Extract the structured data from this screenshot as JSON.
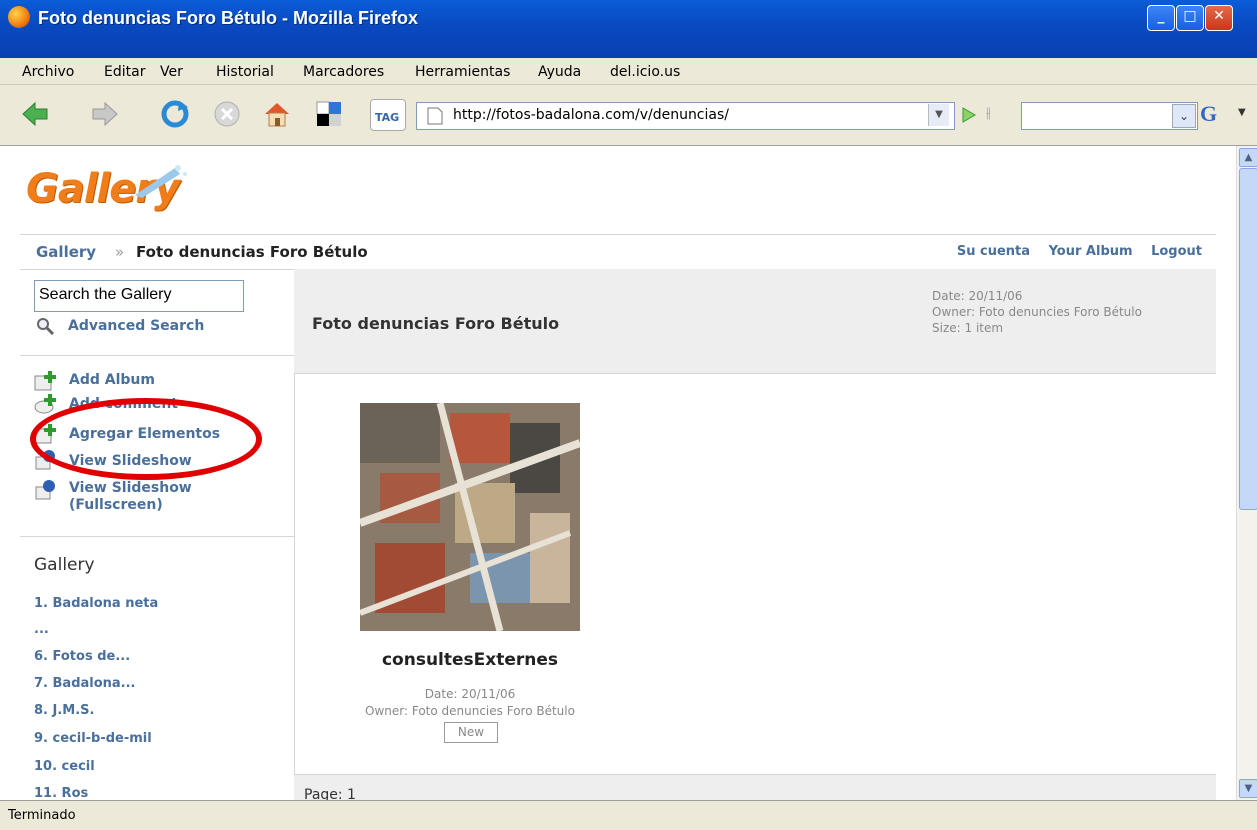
{
  "window": {
    "title": "Foto denuncias Foro Bétulo - Mozilla Firefox"
  },
  "menu": {
    "items": [
      "Archivo",
      "Editar",
      "Ver",
      "Historial",
      "Marcadores",
      "Herramientas",
      "Ayuda",
      "del.icio.us"
    ]
  },
  "toolbar": {
    "url": "http://fotos-badalona.com/v/denuncias/",
    "tag_label": "TAG",
    "search_value": ""
  },
  "gallery": {
    "logo": "Gallery",
    "breadcrumb": {
      "root": "Gallery",
      "separator": "»",
      "current": "Foto denuncias Foro Bétulo"
    },
    "top_links": [
      "Su cuenta",
      "Your Album",
      "Logout"
    ],
    "sidebar": {
      "search_placeholder": "Search the Gallery",
      "advanced_search": "Advanced Search",
      "actions": [
        "Add Album",
        "Add comment",
        "Agregar Elementos",
        "View Slideshow",
        "View Slideshow (Fullscreen)"
      ],
      "heading": "Gallery",
      "albums": [
        "1. Badalona neta",
        "...",
        "6. Fotos de...",
        "7. Badalona...",
        "8. J.M.S.",
        "9. cecil-b-de-mil",
        "10. cecil",
        "11. Ros"
      ]
    },
    "album": {
      "title": "Foto denuncias Foro Bétulo",
      "date": "Date: 20/11/06",
      "owner": "Owner: Foto denuncies Foro Bétulo",
      "size": "Size: 1 item"
    },
    "item": {
      "title": "consultesExternes",
      "date": "Date: 20/11/06",
      "owner": "Owner: Foto denuncies Foro Bétulo",
      "badge": "New"
    },
    "pager": "Page: 1"
  },
  "status": {
    "text": "Terminado"
  },
  "colors": {
    "link": "#4a6f9a",
    "annotation": "#e00000",
    "titlebar": "#0a49c0"
  }
}
